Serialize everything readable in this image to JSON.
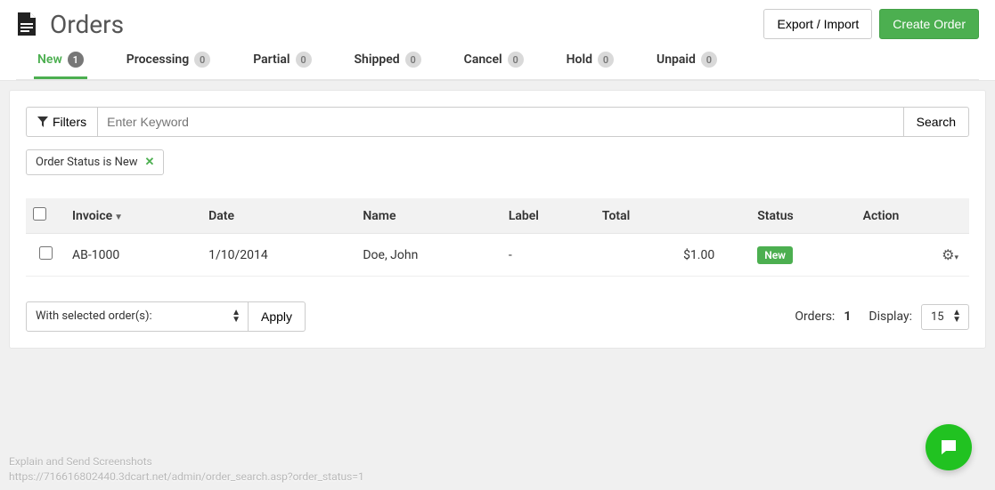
{
  "header": {
    "title": "Orders",
    "export_import_label": "Export / Import",
    "create_label": "Create Order"
  },
  "tabs": [
    {
      "label": "New",
      "count": 1,
      "active": true
    },
    {
      "label": "Processing",
      "count": 0,
      "active": false
    },
    {
      "label": "Partial",
      "count": 0,
      "active": false
    },
    {
      "label": "Shipped",
      "count": 0,
      "active": false
    },
    {
      "label": "Cancel",
      "count": 0,
      "active": false
    },
    {
      "label": "Hold",
      "count": 0,
      "active": false
    },
    {
      "label": "Unpaid",
      "count": 0,
      "active": false
    }
  ],
  "filters": {
    "button_label": "Filters",
    "search_placeholder": "Enter Keyword",
    "search_button_label": "Search",
    "active_tag": "Order Status is New"
  },
  "table": {
    "columns": {
      "invoice": "Invoice",
      "date": "Date",
      "name": "Name",
      "label": "Label",
      "total": "Total",
      "status": "Status",
      "action": "Action"
    },
    "rows": [
      {
        "invoice": "AB-1000",
        "date": "1/10/2014",
        "name": "Doe, John",
        "label": "-",
        "total": "$1.00",
        "status": "New"
      }
    ]
  },
  "bulk": {
    "select_label": "With selected order(s):",
    "apply_label": "Apply"
  },
  "summary": {
    "orders_label": "Orders:",
    "orders_count": "1",
    "display_label": "Display:",
    "display_value": "15"
  },
  "footer": {
    "line1": "Explain and Send Screenshots",
    "line2": "https://716616802440.3dcart.net/admin/order_search.asp?order_status=1"
  }
}
